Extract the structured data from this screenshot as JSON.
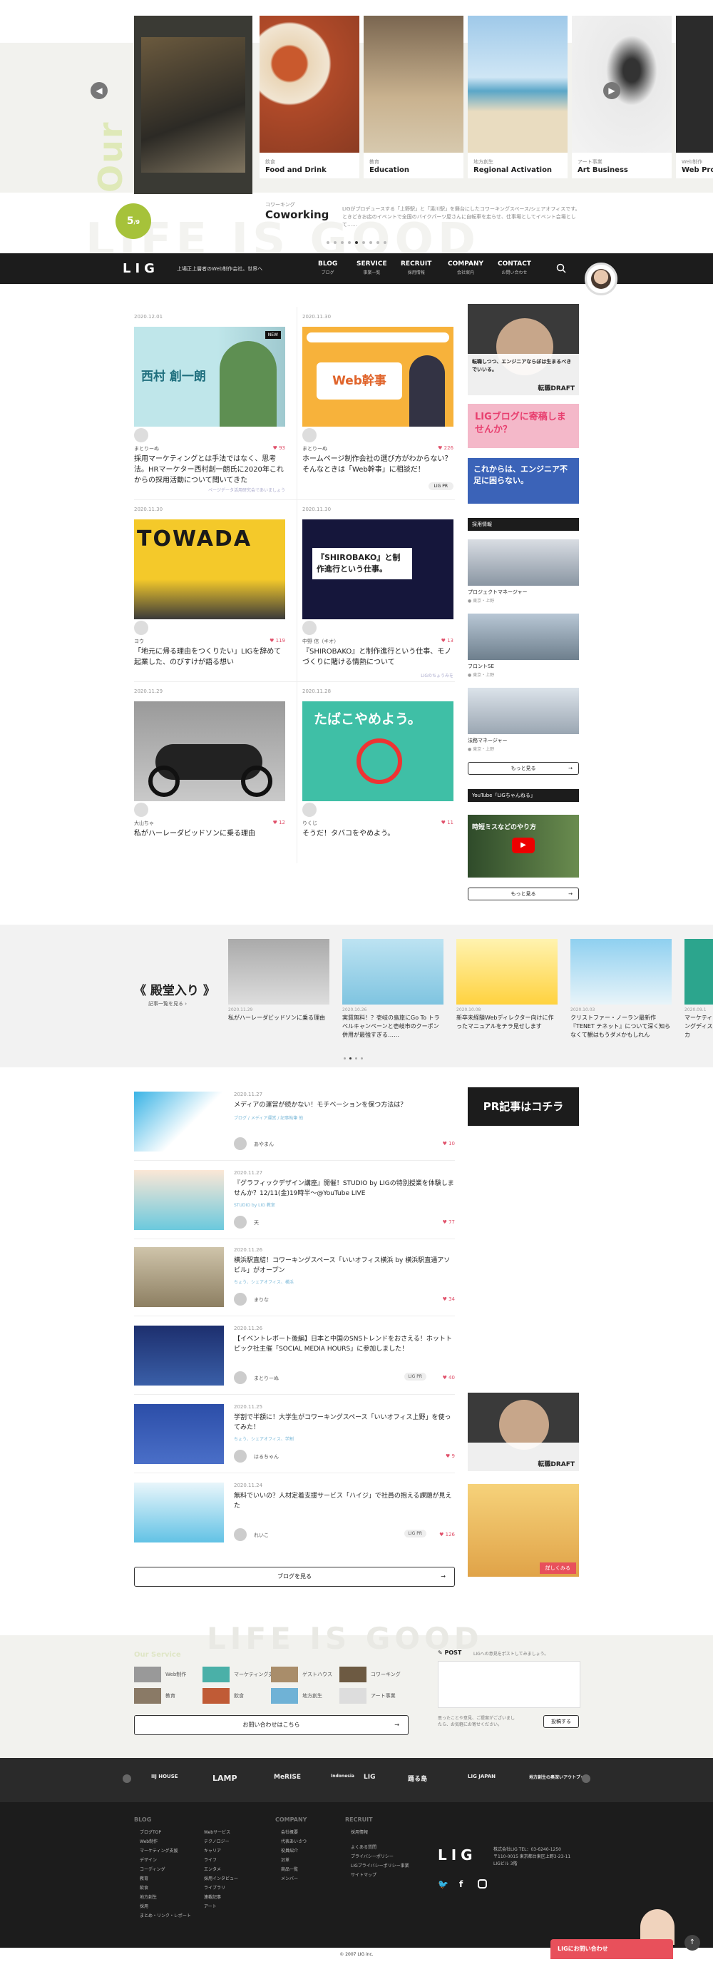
{
  "hero": {
    "vertical_title": "Our Service",
    "background_text": "LIFE IS GOOD",
    "counter": "5",
    "counter_small": "9",
    "main": {
      "category": "コワーキング",
      "title": "Coworking",
      "description": "LIGがプロデュースする「上野駅」と「湯川駅」を舞台にしたコワーキングスペース/シェアオフィスです。ときどきお店のイベントで全国のバイクパーツ屋さんに自転車を走らせ、仕事場としてイベント会場として……"
    },
    "slides": [
      {
        "category": "飲食",
        "title": "Food and Drink"
      },
      {
        "category": "教育",
        "title": "Education"
      },
      {
        "category": "地方創生",
        "title": "Regional Activation"
      },
      {
        "category": "アート事業",
        "title": "Art Business"
      },
      {
        "category": "Web制作",
        "title": "Web Pro"
      }
    ]
  },
  "header": {
    "logo": "LIG",
    "tagline": "上場正上層者のWeb制作会社。世界へ",
    "nav": [
      {
        "en": "BLOG",
        "jp": "ブログ"
      },
      {
        "en": "SERVICE",
        "jp": "事業一覧"
      },
      {
        "en": "RECRUIT",
        "jp": "採用情報"
      },
      {
        "en": "COMPANY",
        "jp": "会社案内"
      },
      {
        "en": "CONTACT",
        "jp": "お問い合わせ"
      }
    ]
  },
  "articles": [
    {
      "date": "2020.12.01",
      "author": "まとりーぬ",
      "likes": "93",
      "badge": "NEW",
      "title": "採用マーケティングとは手法ではなく、思考法。HRマーケター西村創一朗氏に2020年これからの採用活動について聞いてきた",
      "sub": "ページデータ活用研究会であいましょう",
      "img_text": "西村 創一朗"
    },
    {
      "date": "2020.11.30",
      "author": "まとりーぬ",
      "likes": "226",
      "badge": "LIG PR",
      "title": "ホームページ制作会社の選び方がわからない？そんなときは「Web幹事」に相談だ！",
      "sub": "",
      "img_text": "Web幹事"
    },
    {
      "date": "2020.11.30",
      "author": "ヨウ",
      "likes": "119",
      "badge": "",
      "title": "「地元に帰る理由をつくりたい」LIGを辞めて起業した、のびすけが語る想い",
      "sub": "",
      "img_text": "TOWADA"
    },
    {
      "date": "2020.11.30",
      "author": "中野 信（キオ）",
      "likes": "13",
      "badge": "",
      "title": "『SHIROBAKO』と制作進行という仕事、モノづくりに賭ける情熱について",
      "sub": "LIGのちょうみを",
      "img_text": "『SHIROBAKO』と制作進行という仕事。"
    },
    {
      "date": "2020.11.29",
      "author": "大山ちゃ",
      "likes": "12",
      "badge": "",
      "title": "私がハーレーダビッドソンに乗る理由",
      "sub": "",
      "img_text": ""
    },
    {
      "date": "2020.11.28",
      "author": "りくじ",
      "likes": "11",
      "badge": "",
      "title": "そうだ！タバコをやめよう。",
      "sub": "",
      "img_text": "たばこやめよう。"
    }
  ],
  "sidebar": {
    "ad1_text": "転職しつつ、エンジニアならぼは生まるべきでいいる。",
    "ad1_brand": "転職DRAFT",
    "ad2_text": "LIGブログに寄稿しませんか？",
    "ad3_text": "これからは、エンジニア不足に困らない。",
    "recruit_head": "採用情報",
    "jobs": [
      {
        "title": "プロジェクトマネージャー",
        "place": "東京・上野"
      },
      {
        "title": "フロントSE",
        "place": "東京・上野"
      },
      {
        "title": "法務マネージャー",
        "place": "東京・上野"
      }
    ],
    "more": "もっと見る",
    "youtube_head": "YouTube「LIGちゃんねる」",
    "youtube_text": "時短ミスなどのやり方"
  },
  "fame": {
    "title": "殿堂入り",
    "more": "記事一覧を見る",
    "items": [
      {
        "date": "2020.11.29",
        "title": "私がハーレーダビッドソンに乗る理由"
      },
      {
        "date": "2020.10.26",
        "title": "実質無料！？壱岐の島旅にGo To トラベルキャンペーンと壱岐市のクーポン併用が最強すぎる……"
      },
      {
        "date": "2020.10.08",
        "title": "新卒未経験Webディレクター向けに作ったマニュアルをチラ見せします"
      },
      {
        "date": "2020.10.03",
        "title": "クリストファー・ノーラン最新作『TENET テネット』について深く知らなくて観はもうダメかもしれん"
      },
      {
        "date": "2020.09.1",
        "title": "マーケティングディスカ"
      }
    ]
  },
  "list": [
    {
      "date": "2020.11.27",
      "title": "メディアの運営が続かない！モチベーションを保つ方法は？",
      "cat": "ブログ / メディア運営 / 記事執筆 他",
      "author": "あやまん",
      "likes": "10",
      "badge": ""
    },
    {
      "date": "2020.11.27",
      "title": "『グラフィックデザイン講座』開催！STUDIO by LIGの特別授業を体験しませんか？12/11(金)19時半〜@YouTube LIVE",
      "cat": "STUDIO by LIG 教室",
      "author": "天",
      "likes": "77",
      "badge": ""
    },
    {
      "date": "2020.11.26",
      "title": "横浜駅直結！コワーキングスペース「いいオフィス横浜 by 横浜駅直通アソビル」がオープン",
      "cat": "ちょう、シェアオフィス、横浜",
      "author": "まりな",
      "likes": "34",
      "badge": ""
    },
    {
      "date": "2020.11.26",
      "title": "【イベントレポート後編】日本と中国のSNSトレンドをおさえる！ホットトピック社主催「SOCIAL MEDIA HOURS」に参加しました！",
      "cat": "",
      "author": "まとりーぬ",
      "likes": "40",
      "badge": "LIG PR"
    },
    {
      "date": "2020.11.25",
      "title": "学割で半額に！大学生がコワーキングスペース「いいオフィス上野」を使ってみた！",
      "cat": "ちょう、シェアオフィス、学割",
      "author": "はるちゃん",
      "likes": "9",
      "badge": ""
    },
    {
      "date": "2020.11.24",
      "title": "無料でいいの？人材定着支援サービス「ハイジ」で社員の抱える課題が見えた",
      "cat": "",
      "author": "れいこ",
      "likes": "126",
      "badge": "LIG PR"
    }
  ],
  "list_ad": {
    "pr_text": "PR記事はコチラ",
    "ad_brand": "転職DRAFT",
    "cta": "詳しくみる"
  },
  "blog_button": "ブログを見る",
  "service_footer": {
    "title": "Our Service",
    "bg": "LIFE IS GOOD",
    "items": [
      "Web制作",
      "マーケティング支援",
      "ゲストハウス",
      "コワーキング",
      "教育",
      "飲食",
      "地方創生",
      "アート事業"
    ],
    "contact": "お問い合わせはこちら",
    "post_head": "POST",
    "post_hint": "LIGへの意見をポストしてみましょう。",
    "post_note": "思ったことや意見、ご提案がございましたら、お気軽にお寄せください。",
    "post_btn": "投稿する"
  },
  "partners": [
    "IIJ HOUSE",
    "LAMP",
    "MeRISE",
    "Indonesia",
    "LIG",
    "踊る島",
    "LIG JAPAN",
    "地方創生の奥深いアウトプット"
  ],
  "footer": {
    "blog_h": "BLOG",
    "blog": [
      "ブログTOP",
      "Web制作",
      "マーケティング支援",
      "デザイン",
      "コーディング",
      "教育",
      "飲食",
      "地方創生",
      "採用",
      "まとめ・リンク・レポート"
    ],
    "blog2": [
      "Webサービス",
      "テクノロジー",
      "キャリア",
      "ライフ",
      "エンタメ",
      "採用インタビュー",
      "ライブラリ",
      "連載記事",
      "アート"
    ],
    "company_h": "COMPANY",
    "company": [
      "会社概要",
      "代表あいさつ",
      "役員紹介",
      "沿革",
      "商品一覧",
      "メンバー"
    ],
    "recruit_h": "RECRUIT",
    "recruit": [
      "採用情報",
      "よくある質問",
      "プライバシーポリシー",
      "LIGプライバシーポリシー事業",
      "サイトマップ"
    ],
    "logo": "LIG",
    "address": "株式会社LIG TEL：03-6240-1250",
    "address2": "〒110-0015 東京都台東区上野3-23-11",
    "address3": "LIGビル 3階",
    "copyright": "© 2007 LIG inc.",
    "chat": "LIGにお問い合わせ"
  }
}
